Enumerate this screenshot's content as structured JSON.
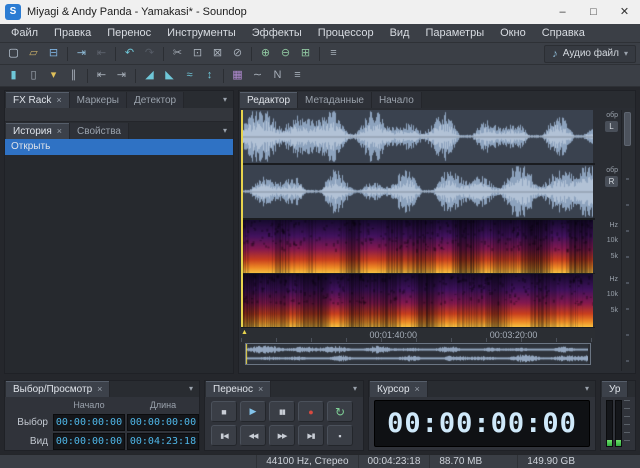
{
  "ui": {
    "caret": "▾",
    "playhead_marker": "▲"
  },
  "colors": {
    "selection": "#2f72c4",
    "playhead": "#e8d44d",
    "record": "#d84a40",
    "play": "#83c3ea",
    "meter_green": "#2fae3e",
    "spectro_hot": "#ee8b25"
  },
  "window": {
    "icon_letter": "S",
    "title": "Miyagi & Andy Panda - Yamakasi* - Soundop",
    "controls": {
      "minimize": "–",
      "maximize": "□",
      "close": "✕"
    }
  },
  "menu": {
    "items": [
      {
        "name": "menu-file",
        "label": "Файл"
      },
      {
        "name": "menu-edit",
        "label": "Правка"
      },
      {
        "name": "menu-transport",
        "label": "Перенос"
      },
      {
        "name": "menu-tools",
        "label": "Инструменты"
      },
      {
        "name": "menu-effects",
        "label": "Эффекты"
      },
      {
        "name": "menu-processor",
        "label": "Процессор"
      },
      {
        "name": "menu-view",
        "label": "Вид"
      },
      {
        "name": "menu-options",
        "label": "Параметры"
      },
      {
        "name": "menu-window",
        "label": "Окно"
      },
      {
        "name": "menu-help",
        "label": "Справка"
      }
    ]
  },
  "toolbar_top": {
    "icons": [
      {
        "name": "new-file-icon",
        "glyph": "▢",
        "color": "#c8d6e4"
      },
      {
        "name": "open-folder-icon",
        "glyph": "▱",
        "color": "#c9af69"
      },
      {
        "name": "save-icon",
        "glyph": "⊟",
        "color": "#7fb2e0"
      },
      {
        "name": "toolbar-separator",
        "cls": "sep"
      },
      {
        "name": "import-audio-icon",
        "glyph": "⇥",
        "color": "#8fbcd8"
      },
      {
        "name": "export-audio-icon",
        "glyph": "⇤",
        "color": "#5d636d"
      },
      {
        "name": "toolbar-separator",
        "cls": "sep"
      },
      {
        "name": "undo-icon",
        "glyph": "↶",
        "color": "#6fc7d8"
      },
      {
        "name": "redo-icon",
        "glyph": "↷",
        "color": "#565c66"
      },
      {
        "name": "toolbar-separator",
        "cls": "sep"
      },
      {
        "name": "cut-icon",
        "glyph": "✂",
        "color": "#a6aeb8"
      },
      {
        "name": "copy-icon",
        "glyph": "⊡",
        "color": "#a6aeb8"
      },
      {
        "name": "paste-icon",
        "glyph": "⊠",
        "color": "#a6aeb8"
      },
      {
        "name": "delete-icon",
        "glyph": "⊘",
        "color": "#a6aeb8"
      },
      {
        "name": "toolbar-separator",
        "cls": "sep"
      },
      {
        "name": "zoom-in-icon",
        "glyph": "⊕",
        "color": "#8fc7a0"
      },
      {
        "name": "zoom-out-icon",
        "glyph": "⊖",
        "color": "#8fc7a0"
      },
      {
        "name": "zoom-fit-icon",
        "glyph": "⊞",
        "color": "#8fc7a0"
      },
      {
        "name": "toolbar-separator",
        "cls": "sep"
      },
      {
        "name": "mixer-icon",
        "glyph": "≡",
        "color": "#a6aeb8"
      }
    ],
    "audio_file": {
      "icon": "♪",
      "label": "Аудио файл",
      "caret": "▾"
    }
  },
  "toolbar_edit": {
    "icons": [
      {
        "name": "time-selection-tool-icon",
        "glyph": "▮",
        "color": "#6fc7d8"
      },
      {
        "name": "scrub-tool-icon",
        "glyph": "▯",
        "color": "#a6aeb8"
      },
      {
        "name": "marker-tool-icon",
        "glyph": "▾",
        "color": "#e0c05a"
      },
      {
        "name": "snap-toggle-icon",
        "glyph": "∥",
        "color": "#a6aeb8"
      },
      {
        "name": "toolbar-separator",
        "cls": "sep"
      },
      {
        "name": "go-start-icon",
        "glyph": "⇤",
        "color": "#a6aeb8"
      },
      {
        "name": "go-end-icon",
        "glyph": "⇥",
        "color": "#a6aeb8"
      },
      {
        "name": "toolbar-separator",
        "cls": "sep"
      },
      {
        "name": "fade-in-icon",
        "glyph": "◢",
        "color": "#6fc7d8"
      },
      {
        "name": "fade-out-icon",
        "glyph": "◣",
        "color": "#6fc7d8"
      },
      {
        "name": "amplify-icon",
        "glyph": "≈",
        "color": "#6fc7d8"
      },
      {
        "name": "normalize-icon",
        "glyph": "↕",
        "color": "#6fc7d8"
      },
      {
        "name": "toolbar-separator",
        "cls": "sep"
      },
      {
        "name": "spectral-view-icon",
        "glyph": "▦",
        "color": "#b08ad0"
      },
      {
        "name": "waveform-view-icon",
        "glyph": "∼",
        "color": "#a6aeb8"
      },
      {
        "name": "noise-tool-icon",
        "glyph": "N",
        "color": "#a6aeb8"
      },
      {
        "name": "panel-menu-icon",
        "glyph": "≡",
        "color": "#a6aeb8"
      }
    ]
  },
  "left_dock": {
    "tabs": [
      {
        "name": "tab-fx-rack",
        "label": "FX Rack",
        "close": "×",
        "cls": "active"
      },
      {
        "name": "tab-markers",
        "label": "Маркеры"
      },
      {
        "name": "tab-detector",
        "label": "Детектор"
      }
    ],
    "inner_tabs": [
      {
        "name": "tab-history",
        "label": "История",
        "close": "×",
        "cls": "active"
      },
      {
        "name": "tab-properties",
        "label": "Свойства"
      }
    ],
    "history_items": [
      {
        "name": "history-item-open",
        "label": "Открыть",
        "cls": "selected"
      }
    ]
  },
  "editor": {
    "tabs": [
      {
        "name": "tab-editor",
        "label": "Редактор",
        "cls": "active"
      },
      {
        "name": "tab-metadata",
        "label": "Метаданные"
      },
      {
        "name": "tab-start",
        "label": "Начало"
      }
    ],
    "ruler": {
      "unit": "обр",
      "left": "L",
      "right": "R",
      "hz": "Hz",
      "k10": "10k",
      "k5": "5k"
    },
    "timeline": {
      "labels": [
        {
          "text": "00:01:40:00",
          "pos": "43%"
        },
        {
          "text": "00:03:20:00",
          "pos": "77%"
        }
      ]
    }
  },
  "selection_panel": {
    "tab": {
      "label": "Выбор/Просмотр",
      "close": "×"
    },
    "col_start": "Начало",
    "col_length": "Длина",
    "rows": [
      {
        "label": "Выбор",
        "start": "00:00:00:00",
        "length": "00:00:00:00"
      },
      {
        "label": "Вид",
        "start": "00:00:00:00",
        "length": "00:04:23:18"
      }
    ]
  },
  "transport_panel": {
    "tab": {
      "label": "Перенос",
      "close": "×"
    },
    "row1": [
      {
        "name": "stop-button",
        "glyph": "■",
        "color": "#c9ced6"
      },
      {
        "name": "play-button",
        "glyph": "▶",
        "color": "#83c3ea"
      },
      {
        "name": "pause-button",
        "glyph": "▮▮",
        "color": "#c9ced6",
        "cls": "sm"
      },
      {
        "name": "record-button",
        "glyph": "●",
        "color": "#d84a40"
      },
      {
        "name": "loop-button",
        "glyph": "↻",
        "color": "#7fcf96",
        "cls": "lg"
      }
    ],
    "row2": [
      {
        "name": "skip-start-button",
        "glyph": "▮◀",
        "color": "#c9ced6",
        "cls": "sm"
      },
      {
        "name": "rewind-button",
        "glyph": "◀◀",
        "color": "#c9ced6",
        "cls": "sm"
      },
      {
        "name": "fast-forward-button",
        "glyph": "▶▶",
        "color": "#c9ced6",
        "cls": "sm"
      },
      {
        "name": "skip-end-button",
        "glyph": "▶▮",
        "color": "#c9ced6",
        "cls": "sm"
      },
      {
        "name": "record-mode-button",
        "glyph": "▪",
        "color": "#c9ced6"
      }
    ]
  },
  "cursor_panel": {
    "tab": {
      "label": "Курсор",
      "close": "×"
    },
    "value": "00:00:00:00"
  },
  "level_panel": {
    "tab": {
      "label": "Ур"
    }
  },
  "status_bar": {
    "cells": [
      {
        "name": "status-sample-rate",
        "text": "44100 Hz, Стерео"
      },
      {
        "name": "status-duration",
        "text": "00:04:23:18"
      },
      {
        "name": "status-file-size",
        "text": "88.70 MB"
      },
      {
        "name": "status-free-space",
        "text": "149.90 GB",
        "cls": "gap"
      }
    ]
  }
}
